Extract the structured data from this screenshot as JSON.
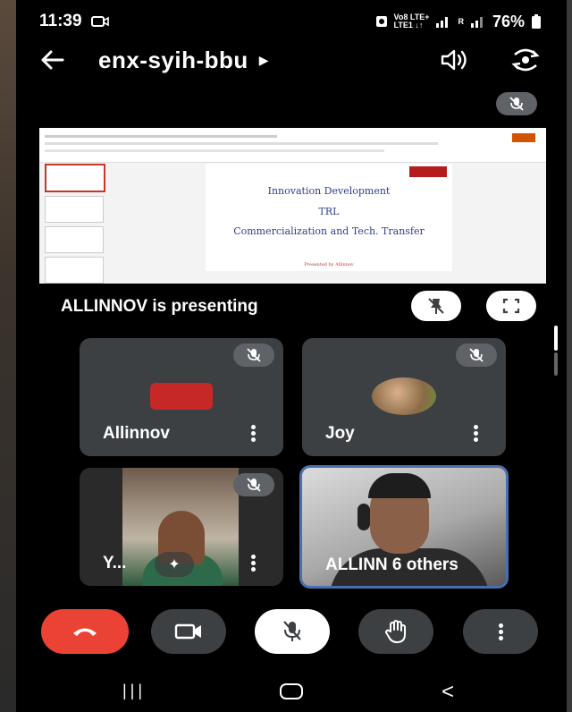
{
  "status_bar": {
    "time": "11:39",
    "network_top": "Vo8 LTE+",
    "network_bottom": "LTE1 ↓↑",
    "sim_label": "R",
    "battery": "76%"
  },
  "header": {
    "meeting_code": "enx-syih-bbu"
  },
  "presentation": {
    "presenter_text": "ALLINNOV is presenting",
    "slide": {
      "line1": "Innovation Development",
      "line2": "TRL",
      "line3": "Commercialization and Tech. Transfer",
      "footer": "Presented by Allinnov"
    }
  },
  "participants": [
    {
      "name": "Allinnov",
      "muted": true
    },
    {
      "name": "Joy",
      "muted": true
    },
    {
      "name": "Y...",
      "muted": true
    },
    {
      "name": "ALLINN 6 others",
      "muted": false
    }
  ],
  "colors": {
    "end_call": "#ea4335",
    "control_bg": "#3c4043",
    "tile_bg": "#3c4043",
    "active_border": "#4a6fb0"
  }
}
